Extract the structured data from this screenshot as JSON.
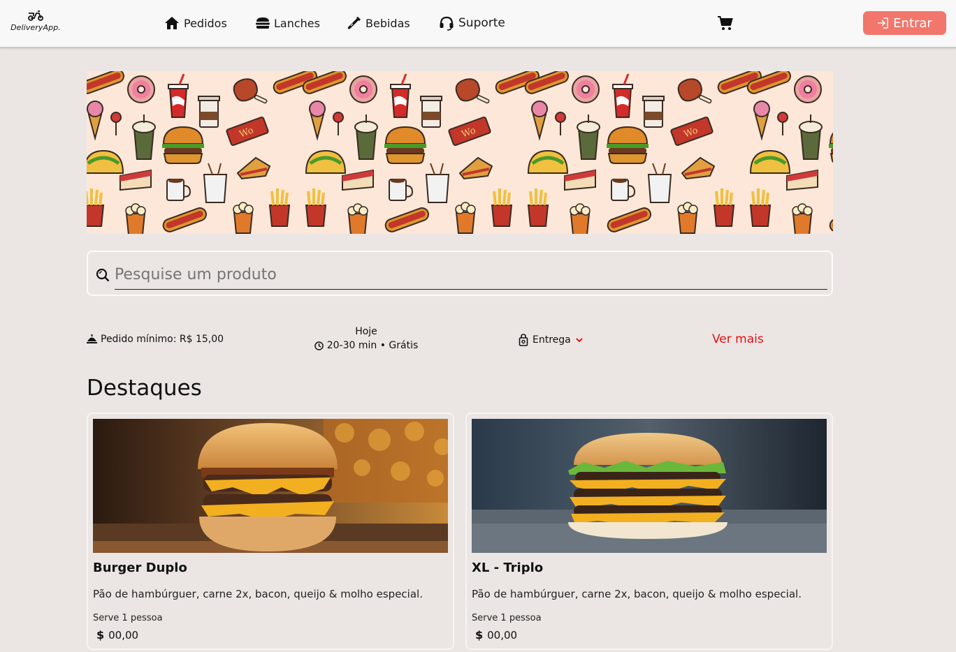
{
  "header": {
    "logo_text": "DeliveryApp.",
    "nav": [
      {
        "label": "Pedidos",
        "icon": "home-icon"
      },
      {
        "label": "Lanches",
        "icon": "burger-icon"
      },
      {
        "label": "Bebidas",
        "icon": "bottle-icon"
      },
      {
        "label": "Suporte",
        "icon": "headset-icon"
      }
    ],
    "cart_icon": "cart-icon",
    "login_label": "Entrar",
    "login_color": "#f2766b"
  },
  "search": {
    "placeholder": "Pesquise um produto"
  },
  "info": {
    "min_order": "Pedido mínimo: R$ 15,00",
    "day": "Hoje",
    "eta": "20-30 min • Grátis",
    "delivery_mode": "Entrega",
    "more_label": "Ver mais",
    "more_color": "#e01010"
  },
  "highlights": {
    "title": "Destaques",
    "products": [
      {
        "name": "Burger Duplo",
        "description": "Pão de hambúrguer, carne 2x, bacon, queijo & molho especial.",
        "serves": "Serve 1 pessoa",
        "currency": "$",
        "price": "00,00"
      },
      {
        "name": "XL - Triplo",
        "description": "Pão de hambúrguer, carne 2x, bacon, queijo & molho especial.",
        "serves": "Serve 1 pessoa",
        "currency": "$",
        "price": "00,00"
      }
    ]
  },
  "colors": {
    "background": "#ebe6e3",
    "header_bg": "#f8f8f8",
    "banner_bg": "#fde7d8"
  }
}
